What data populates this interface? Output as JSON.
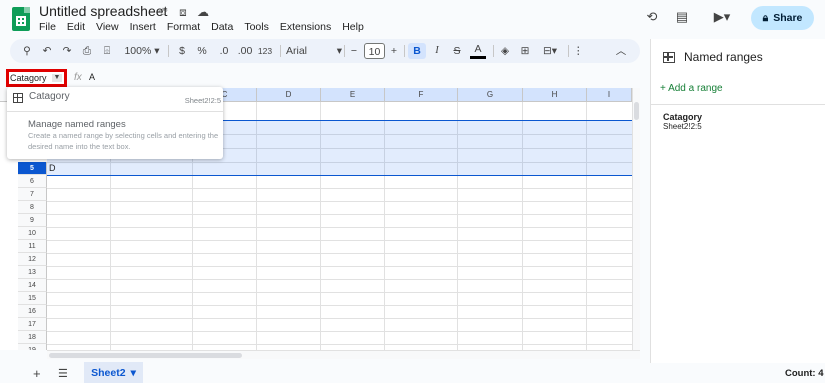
{
  "app": {
    "title": "Untitled spreadsheet",
    "menu": [
      "File",
      "Edit",
      "View",
      "Insert",
      "Format",
      "Data",
      "Tools",
      "Extensions",
      "Help"
    ],
    "share_label": "Share",
    "accent_color": "#0b57d0",
    "highlight_color": "#e00000"
  },
  "toolbar": {
    "zoom": "100%",
    "currency": "$",
    "percent": "%",
    "decrease_decimal": ".0",
    "increase_decimal": ".00",
    "number_format": "123",
    "font": "Arial",
    "font_size": "10",
    "bold": "B",
    "italic": "I",
    "strikethrough": "S",
    "text_color": "A"
  },
  "formula_bar": {
    "name_box": "Catagory",
    "fx": "fx",
    "value": "A"
  },
  "grid": {
    "columns": [
      "C",
      "D",
      "E",
      "F",
      "G",
      "H",
      "I"
    ],
    "rows": [
      "5",
      "6",
      "7",
      "8",
      "9",
      "10",
      "11",
      "12",
      "13",
      "14",
      "15",
      "16",
      "17",
      "18",
      "19"
    ],
    "active_row": "5",
    "cell_value": "D"
  },
  "named_range_dropdown": {
    "item_name": "Catagory",
    "item_range": "Sheet2!2:5",
    "manage_label": "Manage named ranges",
    "manage_desc": "Create a named range by selecting cells and entering the desired name into the text box."
  },
  "named_ranges_panel": {
    "title": "Named ranges",
    "add_label": "Add a range",
    "ranges": [
      {
        "name": "Catagory",
        "ref": "Sheet2!2:5"
      }
    ]
  },
  "footer": {
    "sheet_tab": "Sheet2",
    "count": "Count: 4"
  }
}
